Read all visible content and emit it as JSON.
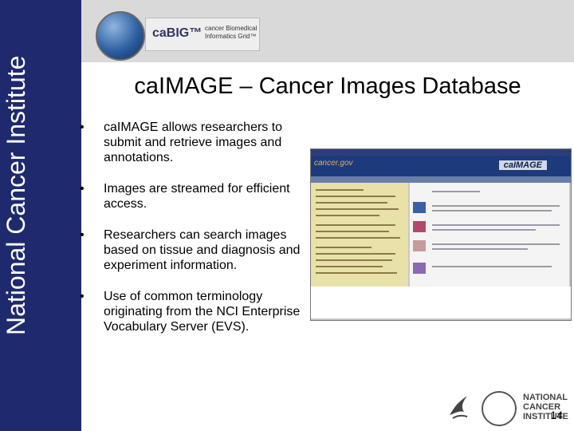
{
  "sidebar": {
    "title": "National Cancer Institute"
  },
  "logo": {
    "brand": "caBIG™",
    "subtitle": "cancer Biomedical Informatics Grid™"
  },
  "slide": {
    "title": "caIMAGE – Cancer Images Database",
    "bullets": [
      {
        "marker": "•",
        "text": "caIMAGE allows researchers to submit and retrieve images and annotations."
      },
      {
        "marker": "•",
        "text": "Images are streamed for efficient access."
      },
      {
        "marker": "•",
        "text": "Researchers can search images based on tissue and diagnosis and experiment information."
      },
      {
        "marker": "•",
        "text": "Use of common terminology originating from the NCI Enterprise Vocabulary Server (EVS)."
      }
    ]
  },
  "screenshot": {
    "brand_left": "cancer.gov",
    "brand_right": "caIMAGE"
  },
  "footer": {
    "nci_logo": "NATIONAL CANCER INSTITUTE",
    "page_number": "14"
  },
  "colors": {
    "sidebar": "#1f2a6e",
    "band": "#d9d9d9"
  }
}
